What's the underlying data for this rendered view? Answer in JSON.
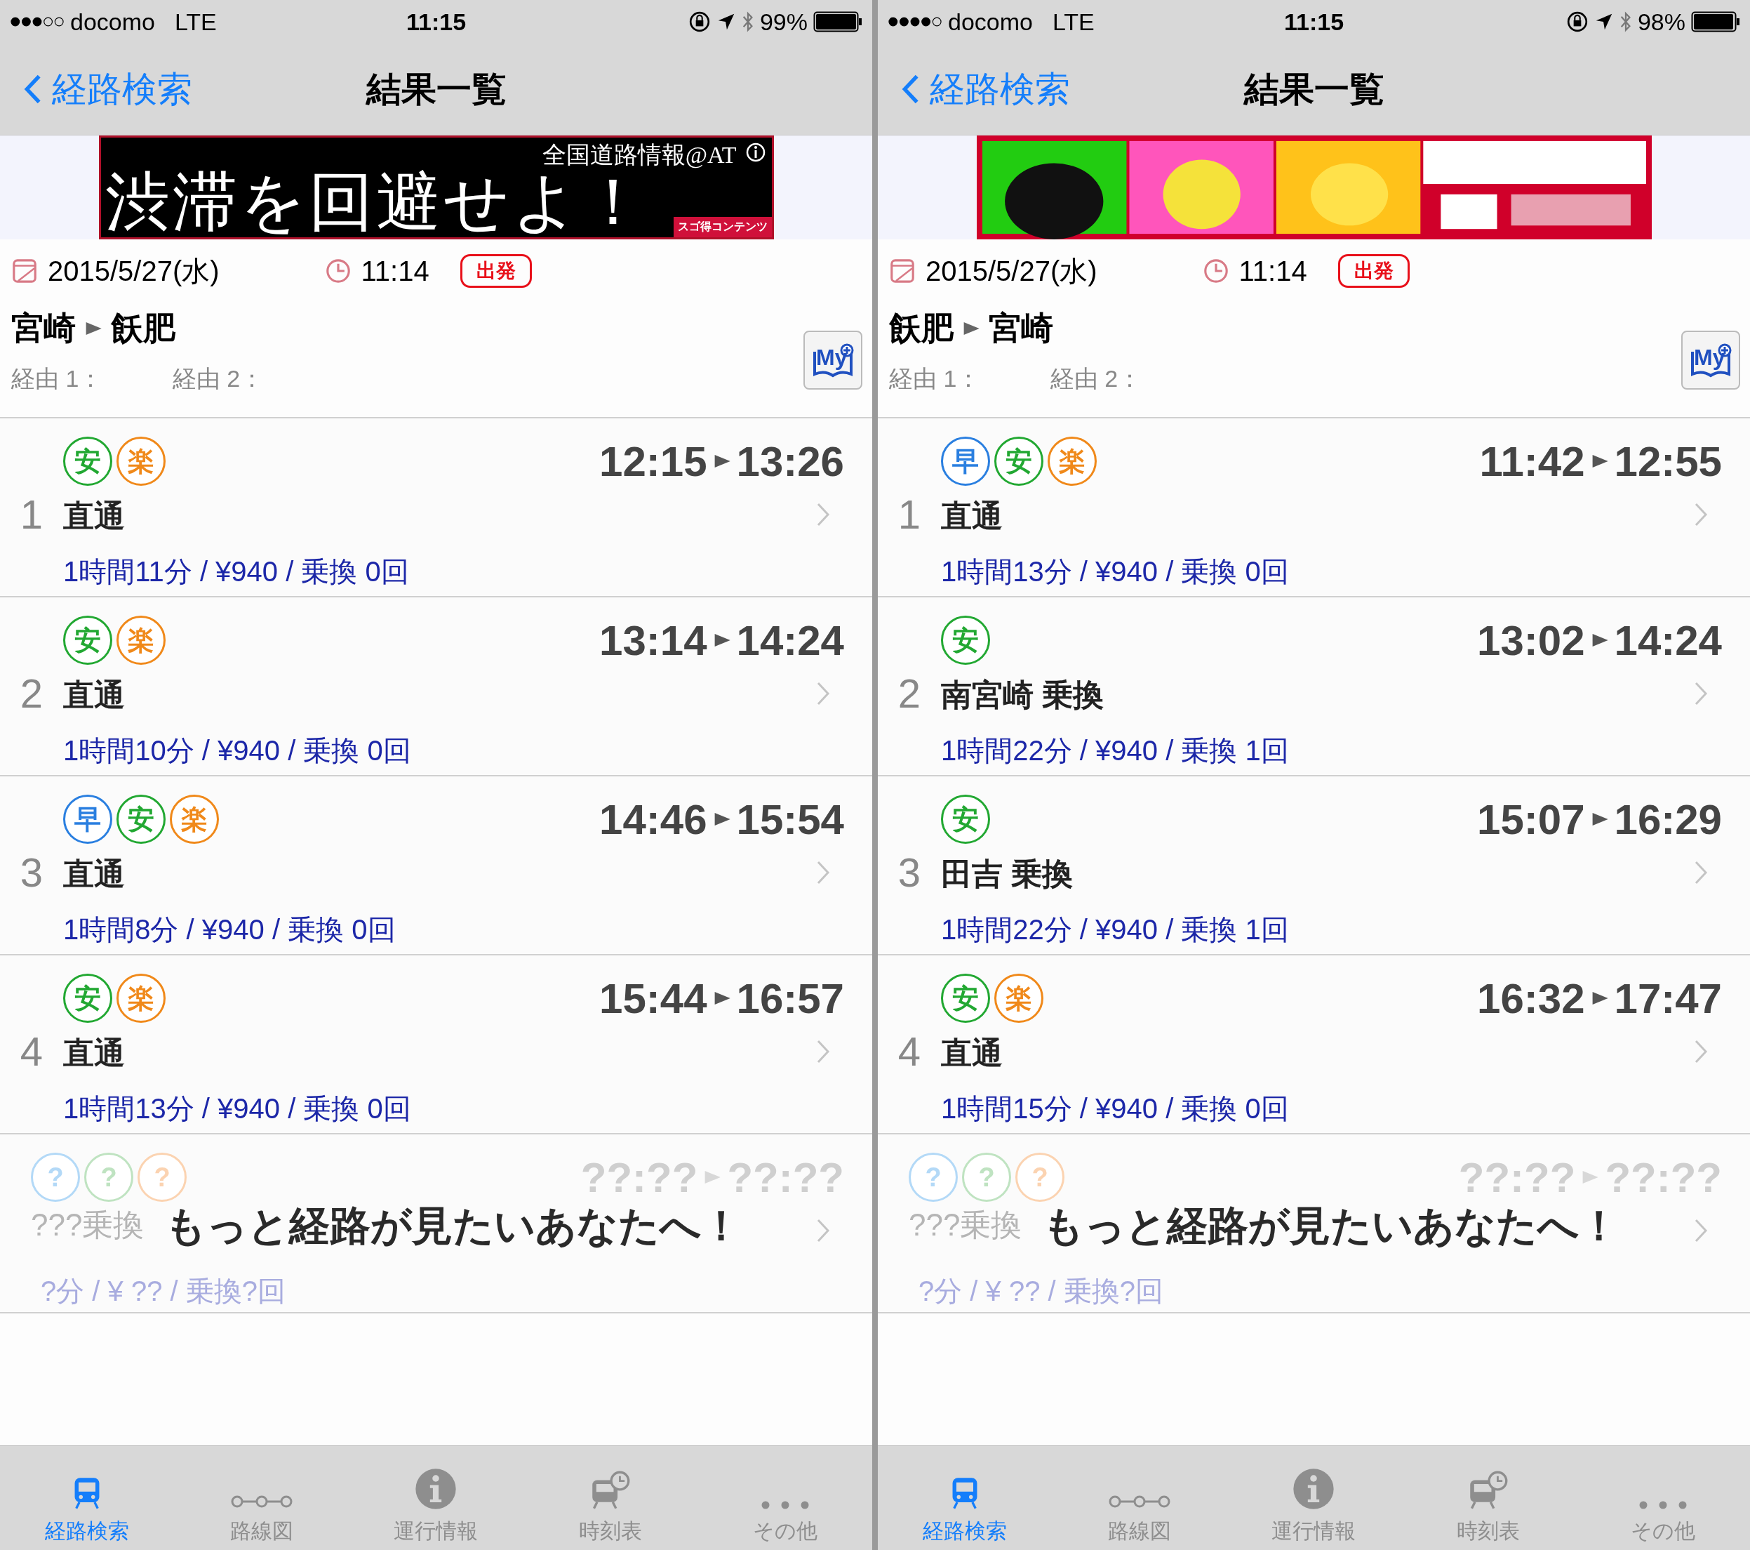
{
  "screens": [
    {
      "status_bar": {
        "carrier": "docomo",
        "network": "LTE",
        "time": "11:15",
        "battery": "99%"
      },
      "nav": {
        "back": "経路検索",
        "title": "結果一覧"
      },
      "ad": {
        "kind": "text",
        "source": "全国道路情報@AT",
        "headline": "渋滞を回避せよ！",
        "brand": "スゴ得コンテンツ"
      },
      "search": {
        "date": "2015/5/27(水)",
        "time": "11:14",
        "mode": "出発",
        "from": "宮崎",
        "to": "飫肥",
        "via_1": "経由 1：",
        "via_2": "経由 2：",
        "my_button": "My"
      },
      "routes": [
        {
          "number": "1",
          "badges": [
            {
              "label": "安",
              "color": "#22a832"
            },
            {
              "label": "楽",
              "color": "#f0891a"
            }
          ],
          "depart": "12:15",
          "arrive": "13:26",
          "transfer": "直通",
          "summary": "1時間11分 / ¥940 / 乗換 0回"
        },
        {
          "number": "2",
          "badges": [
            {
              "label": "安",
              "color": "#22a832"
            },
            {
              "label": "楽",
              "color": "#f0891a"
            }
          ],
          "depart": "13:14",
          "arrive": "14:24",
          "transfer": "直通",
          "summary": "1時間10分 / ¥940 / 乗換 0回"
        },
        {
          "number": "3",
          "badges": [
            {
              "label": "早",
              "color": "#2a7fe0"
            },
            {
              "label": "安",
              "color": "#22a832"
            },
            {
              "label": "楽",
              "color": "#f0891a"
            }
          ],
          "depart": "14:46",
          "arrive": "15:54",
          "transfer": "直通",
          "summary": "1時間8分 / ¥940 / 乗換 0回"
        },
        {
          "number": "4",
          "badges": [
            {
              "label": "安",
              "color": "#22a832"
            },
            {
              "label": "楽",
              "color": "#f0891a"
            }
          ],
          "depart": "15:44",
          "arrive": "16:57",
          "transfer": "直通",
          "summary": "1時間13分 / ¥940 / 乗換 0回"
        }
      ],
      "teaser": {
        "badges": [
          {
            "label": "?",
            "color": "#b3d9f7"
          },
          {
            "label": "?",
            "color": "#bfe3c1"
          },
          {
            "label": "?",
            "color": "#fbd3b1"
          }
        ],
        "depart": "??:??",
        "arrive": "??:??",
        "transfer": "???乗換",
        "summary": "?分 / ¥ ?? / 乗換?回",
        "message": "もっと経路が見たいあなたへ！"
      },
      "tabs": [
        {
          "label": "経路検索",
          "kind": "train",
          "selected": true
        },
        {
          "label": "路線図",
          "kind": "map",
          "selected": false
        },
        {
          "label": "運行情報",
          "kind": "info",
          "selected": false
        },
        {
          "label": "時刻表",
          "kind": "timetable",
          "selected": false
        },
        {
          "label": "その他",
          "kind": "more",
          "selected": false
        }
      ]
    },
    {
      "status_bar": {
        "carrier": "docomo",
        "network": "LTE",
        "time": "11:15",
        "battery": "98%"
      },
      "nav": {
        "back": "経路検索",
        "title": "結果一覧"
      },
      "ad": {
        "kind": "picture"
      },
      "search": {
        "date": "2015/5/27(水)",
        "time": "11:14",
        "mode": "出発",
        "from": "飫肥",
        "to": "宮崎",
        "via_1": "経由 1：",
        "via_2": "経由 2：",
        "my_button": "My"
      },
      "routes": [
        {
          "number": "1",
          "badges": [
            {
              "label": "早",
              "color": "#2a7fe0"
            },
            {
              "label": "安",
              "color": "#22a832"
            },
            {
              "label": "楽",
              "color": "#f0891a"
            }
          ],
          "depart": "11:42",
          "arrive": "12:55",
          "transfer": "直通",
          "summary": "1時間13分 / ¥940 / 乗換 0回"
        },
        {
          "number": "2",
          "badges": [
            {
              "label": "安",
              "color": "#22a832"
            }
          ],
          "depart": "13:02",
          "arrive": "14:24",
          "transfer": "南宮崎 乗換",
          "summary": "1時間22分 / ¥940 / 乗換 1回"
        },
        {
          "number": "3",
          "badges": [
            {
              "label": "安",
              "color": "#22a832"
            }
          ],
          "depart": "15:07",
          "arrive": "16:29",
          "transfer": "田吉 乗換",
          "summary": "1時間22分 / ¥940 / 乗換 1回"
        },
        {
          "number": "4",
          "badges": [
            {
              "label": "安",
              "color": "#22a832"
            },
            {
              "label": "楽",
              "color": "#f0891a"
            }
          ],
          "depart": "16:32",
          "arrive": "17:47",
          "transfer": "直通",
          "summary": "1時間15分 / ¥940 / 乗換 0回"
        }
      ],
      "teaser": {
        "badges": [
          {
            "label": "?",
            "color": "#b3d9f7"
          },
          {
            "label": "?",
            "color": "#bfe3c1"
          },
          {
            "label": "?",
            "color": "#fbd3b1"
          }
        ],
        "depart": "??:??",
        "arrive": "??:??",
        "transfer": "???乗換",
        "summary": "?分 / ¥ ?? / 乗換?回",
        "message": "もっと経路が見たいあなたへ！"
      },
      "tabs": [
        {
          "label": "経路検索",
          "kind": "train",
          "selected": true
        },
        {
          "label": "路線図",
          "kind": "map",
          "selected": false
        },
        {
          "label": "運行情報",
          "kind": "info",
          "selected": false
        },
        {
          "label": "時刻表",
          "kind": "timetable",
          "selected": false
        },
        {
          "label": "その他",
          "kind": "more",
          "selected": false
        }
      ]
    }
  ]
}
